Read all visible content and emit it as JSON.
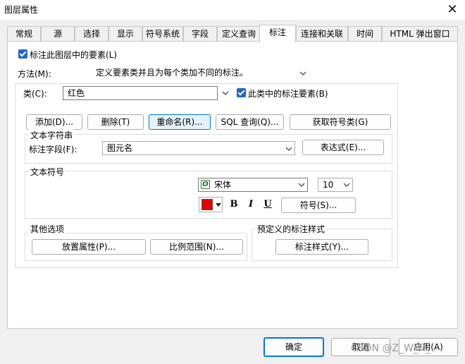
{
  "window": {
    "title": "图层属性",
    "close_glyph": "✕"
  },
  "tabs": [
    {
      "label": "常规",
      "active": false
    },
    {
      "label": "源",
      "active": false
    },
    {
      "label": "选择",
      "active": false
    },
    {
      "label": "显示",
      "active": false
    },
    {
      "label": "符号系统",
      "active": false
    },
    {
      "label": "字段",
      "active": false
    },
    {
      "label": "定义查询",
      "active": false
    },
    {
      "label": "标注",
      "active": true
    },
    {
      "label": "连接和关联",
      "active": false
    },
    {
      "label": "时间",
      "active": false
    },
    {
      "label": "HTML 弹出窗口",
      "active": false
    }
  ],
  "label_layer": {
    "label": "标注此图层中的要素(L)",
    "checked": true
  },
  "method": {
    "label": "方法(M):",
    "value": "定义要素类并且为每个类加不同的标注。"
  },
  "class": {
    "label": "类(C):",
    "value": "红色",
    "class_label_checkbox": {
      "label": "此类中的标注要素(B)",
      "checked": true
    },
    "buttons": {
      "add": "添加(D)...",
      "delete": "删除(T)",
      "rename": "重命名(R)...",
      "sql": "SQL 查询(Q)...",
      "get_classes": "获取符号类(G)"
    }
  },
  "text_string": {
    "group_label": "文本字符串",
    "field_label": "标注字段(F):",
    "field_value": "图元名",
    "expression_button": "表达式(E)..."
  },
  "text_symbol": {
    "group_label": "文本符号",
    "font_icon_glyph": "O",
    "font": "宋体",
    "size": "10",
    "color": "#e00000",
    "bold": "B",
    "italic": "I",
    "underline": "U",
    "symbol_button": "符号(S)..."
  },
  "other_options": {
    "group_label": "其他选项",
    "placement_button": "放置属性(P)...",
    "scale_button": "比例范围(N)..."
  },
  "predefined": {
    "group_label": "预定义的标注样式",
    "style_button": "标注样式(Y)..."
  },
  "footer": {
    "ok": "确定",
    "cancel": "取消",
    "apply": "应用(A)"
  },
  "watermark": "CSDN @Z_W_H_"
}
